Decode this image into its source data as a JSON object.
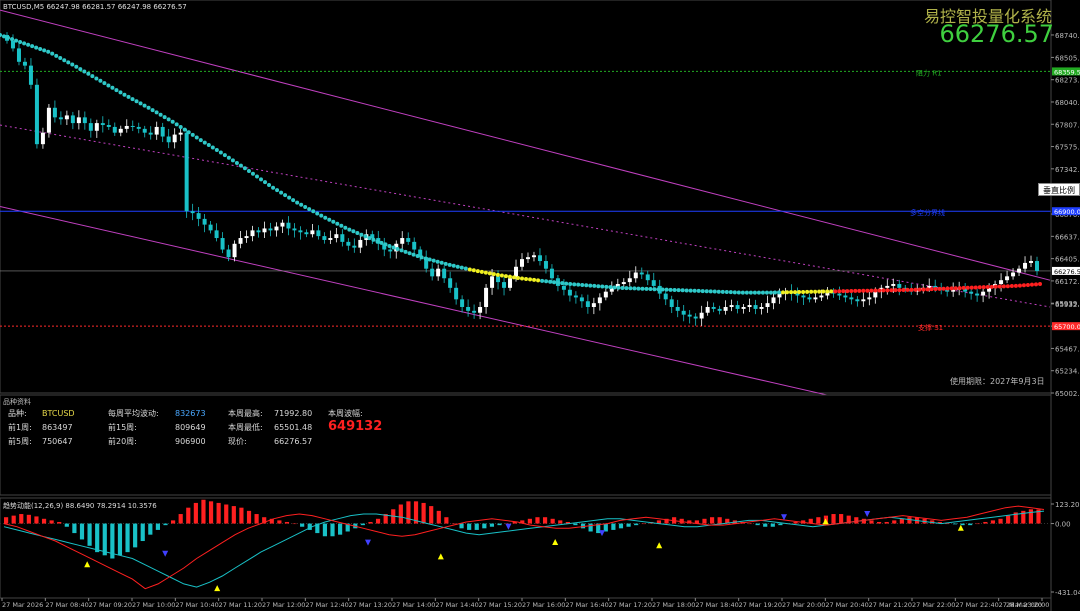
{
  "header": {
    "symbol_info": "BTCUSD,M5  66247.98 66281.57 66247.98 66276.57",
    "brand": "易控智投量化系统",
    "big_price": "66276.57"
  },
  "chart_data": {
    "type": "candlestick",
    "symbol": "BTCUSD",
    "timeframe": "M5",
    "ohlc_latest": {
      "open": 66247.98,
      "high": 66281.57,
      "low": 66247.98,
      "close": 66276.57
    },
    "ylim": [
      65002.05,
      68980
    ],
    "price_ticks": [
      "68740.20",
      "68505.90",
      "68273.25",
      "68040.60",
      "67807.95",
      "67575.30",
      "67342.65",
      "67110.00",
      "66870.35",
      "66637.65",
      "66405.00",
      "66172.35",
      "65939.70",
      "65932.65",
      "65700.00",
      "65467.35",
      "65234.70",
      "65002.05"
    ],
    "time_labels": [
      "27 Mar 2026",
      "27 Mar 08:40",
      "27 Mar 09:20",
      "27 Mar 10:00",
      "27 Mar 10:40",
      "27 Mar 11:20",
      "27 Mar 12:00",
      "27 Mar 12:40",
      "27 Mar 13:20",
      "27 Mar 14:00",
      "27 Mar 14:40",
      "27 Mar 15:20",
      "27 Mar 16:00",
      "27 Mar 16:40",
      "27 Mar 17:20",
      "27 Mar 18:00",
      "27 Mar 18:40",
      "27 Mar 19:20",
      "27 Mar 20:00",
      "27 Mar 20:40",
      "27 Mar 21:20",
      "27 Mar 22:00",
      "27 Mar 22:40",
      "27 Mar 23:20",
      "28 Mar 00:00"
    ],
    "levels": {
      "resistance": {
        "label": "阻力 R1",
        "value": 68359.58,
        "tag": "68359.58",
        "color": "#22aa22"
      },
      "pivot": {
        "label": "多空分界线",
        "value": 66900,
        "tag": "66900.00",
        "color": "#1f3fff"
      },
      "support": {
        "label": "支撑 S1",
        "value": 65700,
        "tag": "65700.00",
        "color": "#ff2a2a"
      },
      "current": {
        "value": 66276.57,
        "tag": "66276.57"
      }
    },
    "candles_close": [
      68680,
      68600,
      68460,
      68420,
      68220,
      67600,
      67720,
      67980,
      67880,
      67860,
      67900,
      67820,
      67880,
      67820,
      67740,
      67820,
      67800,
      67780,
      67720,
      67760,
      67790,
      67780,
      67760,
      67720,
      67700,
      67780,
      67680,
      67620,
      67700,
      67720,
      66900,
      66880,
      66820,
      66760,
      66700,
      66620,
      66500,
      66420,
      66560,
      66620,
      66640,
      66700,
      66680,
      66720,
      66700,
      66740,
      66780,
      66720,
      66700,
      66680,
      66660,
      66700,
      66640,
      66600,
      66620,
      66660,
      66580,
      66540,
      66520,
      66600,
      66660,
      66620,
      66560,
      66500,
      66480,
      66560,
      66620,
      66580,
      66500,
      66420,
      66300,
      66220,
      66300,
      66200,
      66100,
      65980,
      65900,
      65860,
      65840,
      65900,
      66100,
      66220,
      66160,
      66100,
      66200,
      66320,
      66400,
      66420,
      66440,
      66380,
      66300,
      66200,
      66120,
      66080,
      66020,
      66000,
      65960,
      65900,
      65940,
      66000,
      66060,
      66100,
      66140,
      66160,
      66200,
      66260,
      66240,
      66180,
      66120,
      66040,
      65980,
      65900,
      65860,
      65820,
      65800,
      65780,
      65840,
      65900,
      65880,
      65860,
      65900,
      65920,
      65880,
      65900,
      65920,
      65880,
      65900,
      65940,
      66000,
      66040,
      66060,
      66040,
      66020,
      66000,
      65980,
      66000,
      66020,
      66060,
      66040,
      66020,
      66000,
      65980,
      65960,
      65980,
      66000,
      66060,
      66100,
      66120,
      66140,
      66100,
      66080,
      66060,
      66080,
      66100,
      66120,
      66100,
      66080,
      66060,
      66080,
      66100,
      66060,
      66040,
      66020,
      66060,
      66100,
      66140,
      66180,
      66220,
      66260,
      66300,
      66360,
      66380,
      66276.57
    ],
    "ma_values": [
      68740,
      68650,
      68560,
      68420,
      68270,
      68120,
      67980,
      67830,
      67660,
      67500,
      67330,
      67150,
      66990,
      66850,
      66720,
      66610,
      66510,
      66420,
      66350,
      66290,
      66240,
      66200,
      66170,
      66140,
      66120,
      66100,
      66090,
      66080,
      66070,
      66060,
      66050,
      66050,
      66055,
      66060,
      66065,
      66070,
      66075,
      66080,
      66090,
      66100,
      66110,
      66120,
      66140
    ],
    "channel": {
      "upper": [
        [
          0,
          69000
        ],
        [
          1,
          66180
        ]
      ],
      "lower": [
        [
          0,
          66950
        ],
        [
          1,
          64450
        ]
      ],
      "mid": [
        [
          0,
          67800
        ],
        [
          1,
          65900
        ]
      ]
    },
    "oscillator": {
      "label": "趋势动能(12,26,9) 88.6490 78.2914 10.3576",
      "ylim": [
        -431.0446,
        123.2005
      ],
      "ticks": [
        "123.2005",
        "0.00",
        "-431.0446"
      ],
      "histogram": [
        40,
        50,
        60,
        55,
        45,
        30,
        20,
        10,
        -20,
        -60,
        -100,
        -140,
        -180,
        -200,
        -220,
        -200,
        -180,
        -150,
        -110,
        -70,
        -40,
        -10,
        20,
        60,
        100,
        130,
        150,
        140,
        130,
        120,
        110,
        100,
        80,
        60,
        40,
        30,
        20,
        10,
        0,
        -20,
        -40,
        -60,
        -80,
        -80,
        -70,
        -50,
        -30,
        -10,
        10,
        30,
        60,
        90,
        120,
        140,
        140,
        130,
        110,
        80,
        40,
        0,
        -30,
        -40,
        -40,
        -30,
        -20,
        -10,
        0,
        10,
        20,
        30,
        40,
        40,
        30,
        20,
        10,
        -10,
        -30,
        -50,
        -60,
        -50,
        -40,
        -30,
        -20,
        -10,
        0,
        10,
        20,
        30,
        40,
        30,
        20,
        20,
        30,
        40,
        40,
        30,
        20,
        10,
        0,
        -10,
        -20,
        -20,
        -10,
        0,
        10,
        20,
        30,
        40,
        50,
        60,
        60,
        50,
        40,
        30,
        20,
        10,
        10,
        20,
        30,
        40,
        40,
        30,
        20,
        10,
        0,
        -5,
        -10,
        -10,
        0,
        10,
        20,
        30,
        50,
        70,
        80,
        90,
        88.649
      ],
      "signal": [
        -20,
        -40,
        -60,
        -80,
        -100,
        -120,
        -140,
        -160,
        -180,
        -200,
        -220,
        -260,
        -300,
        -340,
        -380,
        -400,
        -370,
        -330,
        -280,
        -230,
        -180,
        -140,
        -100,
        -60,
        -20,
        10,
        30,
        50,
        60,
        60,
        50,
        40,
        20,
        0,
        -20,
        -40,
        -60,
        -70,
        -60,
        -50,
        -40,
        -30,
        -20,
        -10,
        0,
        10,
        20,
        30,
        30,
        20,
        10,
        0,
        -10,
        -20,
        -20,
        -10,
        0,
        10,
        20,
        20,
        10,
        0,
        -10,
        -20,
        -10,
        0,
        10,
        20,
        30,
        40,
        30,
        20,
        10,
        0,
        10,
        20,
        30,
        40,
        50,
        60,
        70,
        78.2914
      ],
      "line2": [
        0,
        -20,
        -50,
        -80,
        -110,
        -150,
        -190,
        -230,
        -270,
        -310,
        -350,
        -410,
        -380,
        -330,
        -280,
        -220,
        -170,
        -120,
        -70,
        -30,
        0,
        30,
        50,
        60,
        50,
        30,
        10,
        -10,
        -30,
        -50,
        -70,
        -80,
        -70,
        -50,
        -30,
        -10,
        10,
        20,
        30,
        20,
        10,
        -10,
        -20,
        -30,
        -30,
        -20,
        -10,
        0,
        20,
        30,
        40,
        30,
        20,
        10,
        0,
        -10,
        -10,
        0,
        10,
        20,
        30,
        20,
        10,
        0,
        -10,
        0,
        10,
        20,
        30,
        40,
        50,
        40,
        30,
        20,
        30,
        40,
        60,
        80,
        100,
        110,
        100,
        88.649
      ],
      "markers": [
        {
          "x": 0.08,
          "y": -250,
          "color": "#ffff00",
          "dir": "up"
        },
        {
          "x": 0.155,
          "y": -190,
          "color": "#4040ff",
          "dir": "down"
        },
        {
          "x": 0.205,
          "y": -400,
          "color": "#ffff00",
          "dir": "up"
        },
        {
          "x": 0.35,
          "y": -120,
          "color": "#4040ff",
          "dir": "down"
        },
        {
          "x": 0.42,
          "y": -200,
          "color": "#ffff00",
          "dir": "up"
        },
        {
          "x": 0.485,
          "y": -20,
          "color": "#4040ff",
          "dir": "down"
        },
        {
          "x": 0.53,
          "y": -110,
          "color": "#ffff00",
          "dir": "up"
        },
        {
          "x": 0.575,
          "y": -60,
          "color": "#4040ff",
          "dir": "down"
        },
        {
          "x": 0.63,
          "y": -130,
          "color": "#ffff00",
          "dir": "up"
        },
        {
          "x": 0.75,
          "y": 40,
          "color": "#4040ff",
          "dir": "down"
        },
        {
          "x": 0.79,
          "y": 20,
          "color": "#ffff00",
          "dir": "up"
        },
        {
          "x": 0.83,
          "y": 60,
          "color": "#4040ff",
          "dir": "down"
        },
        {
          "x": 0.92,
          "y": -20,
          "color": "#ffff00",
          "dir": "up"
        }
      ]
    }
  },
  "info_panel": {
    "title": "品种资料",
    "rows": [
      [
        {
          "k": "品种:",
          "v": "BTCUSD",
          "vc": "#e6d84a"
        },
        {
          "k": "每周平均波动:",
          "v": "832673",
          "vc": "#4aa8ff"
        },
        {
          "k": "本周最高:",
          "v": "71992.80",
          "vc": "#d8d8d8"
        },
        {
          "k": "本周波幅:",
          "v": "",
          "vc": "#d8d8d8"
        }
      ],
      [
        {
          "k": "前1周:",
          "v": "863497",
          "vc": "#d8d8d8"
        },
        {
          "k": "前15周:",
          "v": "809649",
          "vc": "#d8d8d8"
        },
        {
          "k": "本周最低:",
          "v": "65501.48",
          "vc": "#d8d8d8"
        },
        {
          "k": "",
          "v": "649132",
          "vc": "#ff2020",
          "big": true
        }
      ],
      [
        {
          "k": "前5周:",
          "v": "750647",
          "vc": "#d8d8d8"
        },
        {
          "k": "前20周:",
          "v": "906900",
          "vc": "#d8d8d8"
        },
        {
          "k": "现价:",
          "v": "66276.57",
          "vc": "#d8d8d8"
        },
        {
          "k": "",
          "v": "",
          "vc": "#d8d8d8"
        }
      ]
    ],
    "expiry": "使用期限：2027年9月3日"
  },
  "scale_button": "垂直比例",
  "colors": {
    "bull": "#ffffff",
    "bear": "#19c1c7",
    "ma_down": "#2fc8c8",
    "ma_flat": "#f0f020",
    "ma_up": "#ff2020",
    "channel": "#c040c0",
    "grid": "#1e1e1e"
  }
}
